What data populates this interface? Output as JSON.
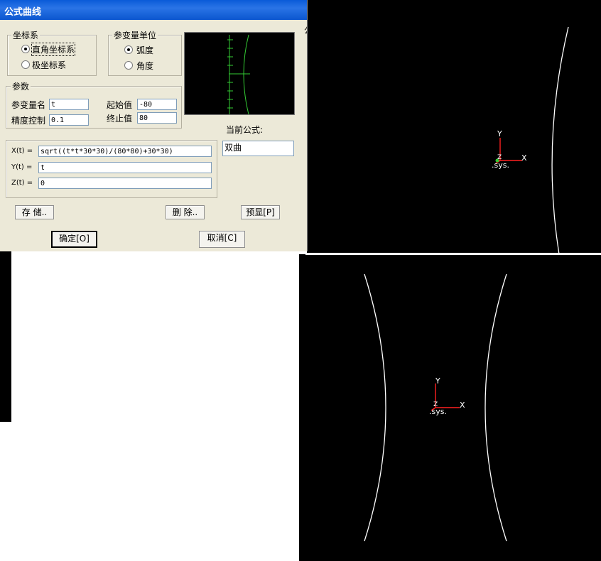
{
  "dialog": {
    "title": "公式曲线",
    "coord_group": {
      "label": "坐标系",
      "options": [
        "直角坐标系",
        "极坐标系"
      ],
      "selected": 0
    },
    "unit_group": {
      "label": "参变量单位",
      "options": [
        "弧度",
        "角度"
      ],
      "selected": 0
    },
    "params_group": {
      "label": "参数",
      "var_name_label": "参变量名",
      "var_name_value": "t",
      "precision_label": "精度控制",
      "precision_value": "0.1",
      "start_label": "起始值",
      "start_value": "-80",
      "end_label": "终止值",
      "end_value": "80"
    },
    "current_formula_label": "当前公式:",
    "current_formula_value": "双曲",
    "formulas": {
      "x_label": "X(t) =",
      "x_value": "sqrt((t*t*30*30)/(80*80)+30*30)",
      "y_label": "Y(t) =",
      "y_value": "t",
      "z_label": "Z(t) =",
      "z_value": "0"
    },
    "buttons": {
      "save": "存 储..",
      "delete": "删 除..",
      "preview": "预显[P]",
      "ok": "确定[O]",
      "cancel": "取消[C]"
    },
    "partial_char": "公"
  },
  "viewport": {
    "axis_x": "X",
    "axis_y": "Y",
    "axis_z": "Z",
    "sys_label": ".sys."
  },
  "colors": {
    "titlebar": "#0a5bd8",
    "preview_curve": "#33cc33",
    "axis_red": "#ff2020"
  }
}
